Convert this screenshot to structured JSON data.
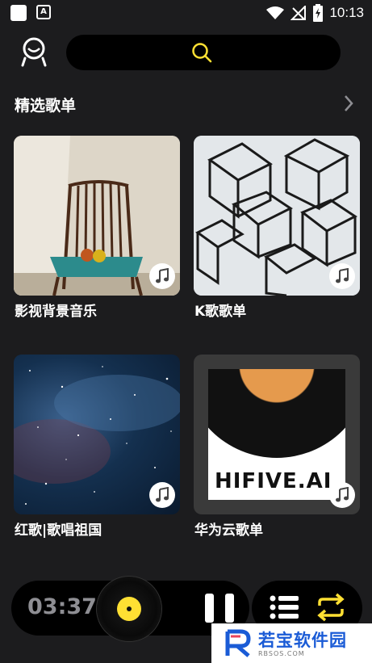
{
  "status_bar": {
    "time": "10:13"
  },
  "search": {
    "placeholder": ""
  },
  "section": {
    "title": "精选歌单"
  },
  "playlists": [
    {
      "title": "影视背景音乐"
    },
    {
      "title": "K歌歌单"
    },
    {
      "title": "红歌|歌唱祖国"
    },
    {
      "title": "华为云歌单"
    }
  ],
  "album_art_text": "HIFIVE.AI",
  "player": {
    "elapsed": "03:37",
    "state": "playing"
  },
  "watermark": {
    "text": "若宝软件园",
    "sub": "RBSOS.COM"
  },
  "colors": {
    "accent": "#ffe033",
    "background": "#1c1c1e",
    "watermark_blue": "#1a5bd6"
  },
  "icons": [
    "avatar-icon",
    "search-icon",
    "chevron-right-icon",
    "music-note-icon",
    "pause-icon",
    "playlist-icon",
    "loop-icon"
  ]
}
